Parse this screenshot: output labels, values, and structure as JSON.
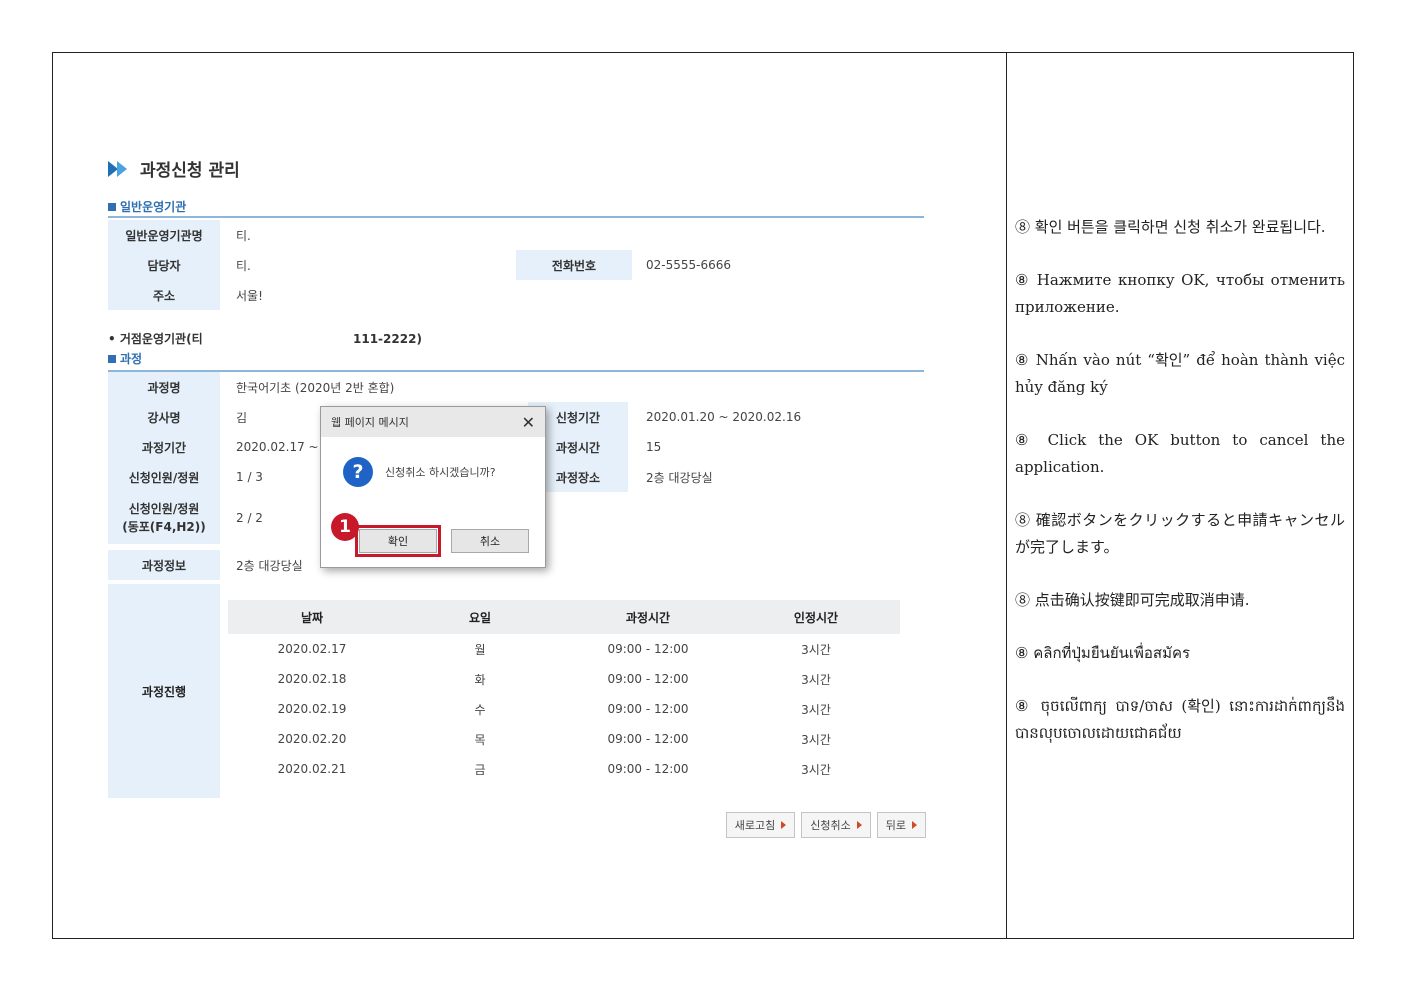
{
  "screenshot": {
    "page_title": "과정신청 관리",
    "section_org": "일반운영기관",
    "org_rows": [
      {
        "label": "일반운영기관명",
        "value": "티."
      },
      {
        "label": "담당자",
        "value": "티.",
        "label2": "전화번호",
        "value2": "02-5555-6666"
      },
      {
        "label": "주소",
        "value": "서울!"
      }
    ],
    "base_org_line": "• 거점운영기관(티                                    111-2222)",
    "section_course": "과정",
    "course_rows": [
      {
        "label": "과정명",
        "value": "한국어기초 (2020년 2반 혼합)"
      },
      {
        "label": "강사명",
        "value": "김",
        "label2": "신청기간",
        "value2": "2020.01.20 ~ 2020.02.16"
      },
      {
        "label": "과정기간",
        "value": "2020.02.17 ~ 20",
        "label2": "과정시간",
        "value2": "15"
      },
      {
        "label": "신청인원/정원",
        "value": "1 / 3",
        "label2": "과정장소",
        "value2": "2층 대강당실"
      },
      {
        "label": "신청인원/정원\n(동포(F4,H2))",
        "value": "2 / 2"
      },
      {
        "label": "과정정보",
        "value": "2층 대강당실"
      }
    ],
    "progress_label": "과정진행",
    "progress_headers": [
      "날짜",
      "요일",
      "과정시간",
      "인정시간"
    ],
    "progress_rows": [
      [
        "2020.02.17",
        "월",
        "09:00 - 12:00",
        "3시간"
      ],
      [
        "2020.02.18",
        "화",
        "09:00 - 12:00",
        "3시간"
      ],
      [
        "2020.02.19",
        "수",
        "09:00 - 12:00",
        "3시간"
      ],
      [
        "2020.02.20",
        "목",
        "09:00 - 12:00",
        "3시간"
      ],
      [
        "2020.02.21",
        "금",
        "09:00 - 12:00",
        "3시간"
      ]
    ],
    "buttons": {
      "refresh": "새로고침",
      "cancel_apply": "신청취소",
      "back": "뒤로"
    },
    "dialog": {
      "title": "웹 페이지 메시지",
      "close": "✕",
      "message": "신청취소 하시겠습니까?",
      "icon": "?",
      "ok": "확인",
      "cancel": "취소",
      "step": "1"
    }
  },
  "notes": [
    "⑧ 확인 버튼을 클릭하면 신청 취소가 완료됩니다.",
    "⑧ Нажмите кнопку OK, чтобы отменить приложение.",
    "⑧ Nhấn vào nút “확인” để hoàn thành việc hủy đăng ký",
    "⑧ Click the OK button to cancel the application.",
    "⑧ 確認ボタンをクリックすると申請キャンセルが完了します。",
    "⑧ 点击确认按键即可完成取消申请.",
    "⑧ คลิกที่ปุ่มยืนยันเพื่อสมัคร",
    "⑧ ចុចលើពាក្យ បាទ/ចាស (확인) នោះការដាក់ពាក្យនឹងបានលុបចោលដោយជោគជ័យ"
  ],
  "colors": {
    "accent": "#2f6fb2",
    "header_bg": "#e6f0fa",
    "highlight": "#c8192b"
  }
}
